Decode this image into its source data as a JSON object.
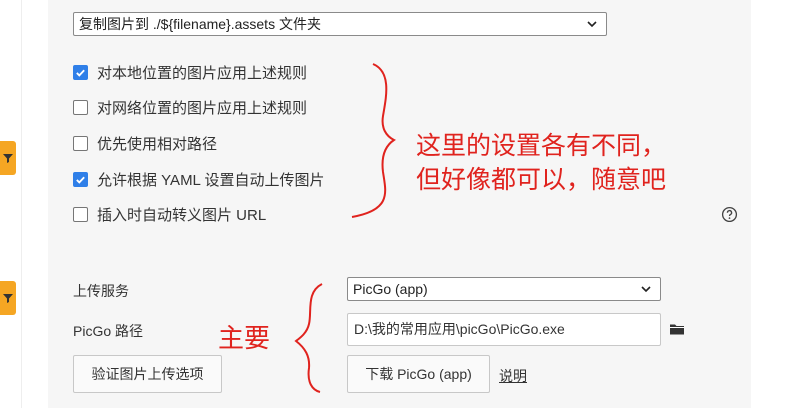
{
  "image_select": {
    "value": "复制图片到 ./${filename}.assets 文件夹"
  },
  "options": [
    {
      "label": "对本地位置的图片应用上述规则",
      "checked": true
    },
    {
      "label": "对网络位置的图片应用上述规则",
      "checked": false
    },
    {
      "label": "优先使用相对路径",
      "checked": false
    },
    {
      "label": "允许根据 YAML 设置自动上传图片",
      "checked": true
    },
    {
      "label": "插入时自动转义图片 URL",
      "checked": false
    }
  ],
  "upload": {
    "service_label": "上传服务",
    "service_value": "PicGo (app)",
    "path_label": "PicGo 路径",
    "path_value": "D:\\我的常用应用\\picGo\\PicGo.exe",
    "verify_button": "验证图片上传选项",
    "download_button": "下载 PicGo (app)",
    "help_link": "说明"
  },
  "annotations": {
    "top_line1": "这里的设置各有不同，",
    "top_line2": "但好像都可以，随意吧",
    "main": "主要"
  },
  "colors": {
    "checkbox_checked": "#2f7fe8",
    "annotation": "#e0231e",
    "side_badge": "#f5a623",
    "panel_bg": "#f6f6f6"
  },
  "icons": [
    "chevron-down-icon",
    "question-circle-icon",
    "folder-icon",
    "filter-icon"
  ]
}
